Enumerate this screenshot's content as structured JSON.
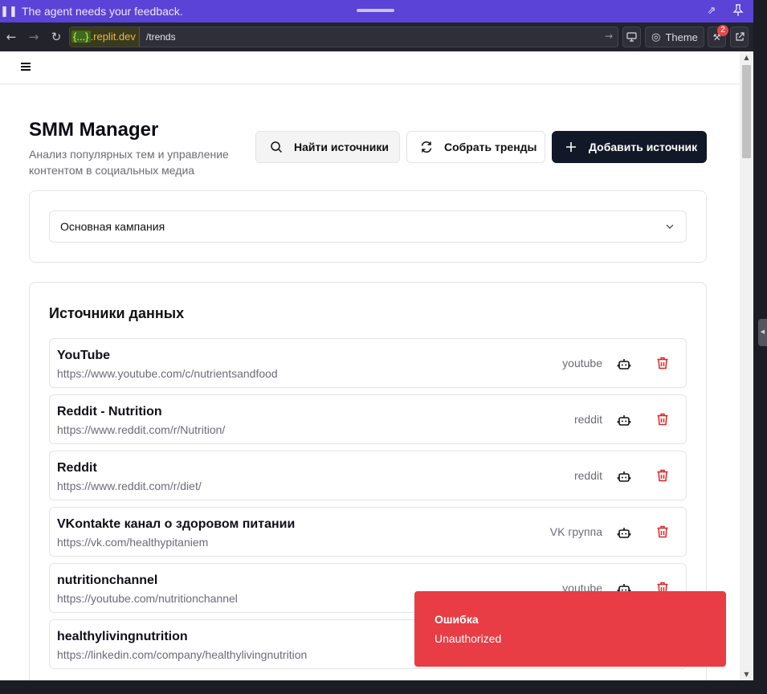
{
  "topbar": {
    "message": "The agent needs your feedback.",
    "pause_icon": "pause-icon",
    "expand_icon": "expand-icon",
    "pin_icon": "pin-icon"
  },
  "browser": {
    "host_prefix": "{...}",
    "host": ".replit.dev",
    "path": "/trends",
    "theme_label": "Theme",
    "devtools_badge": "2"
  },
  "app": {
    "title": "SMM Manager",
    "subtitle": "Анализ популярных тем и управление контентом в социальных медиа",
    "buttons": {
      "find": "Найти источники",
      "collect": "Собрать тренды",
      "add": "Добавить источник"
    },
    "campaign_select": "Основная кампания",
    "sources_title": "Источники данных",
    "sources": [
      {
        "name": "YouTube",
        "url": "https://www.youtube.com/c/nutrientsandfood",
        "type": "youtube"
      },
      {
        "name": "Reddit - Nutrition",
        "url": "https://www.reddit.com/r/Nutrition/",
        "type": "reddit"
      },
      {
        "name": "Reddit",
        "url": "https://www.reddit.com/r/diet/",
        "type": "reddit"
      },
      {
        "name": "VKontakte канал о здоровом питании",
        "url": "https://vk.com/healthypitaniem",
        "type": "VK группа"
      },
      {
        "name": "nutritionchannel",
        "url": "https://youtube.com/nutritionchannel",
        "type": "youtube"
      },
      {
        "name": "healthylivingnutrition",
        "url": "https://linkedin.com/company/healthylivingnutrition",
        "type": ""
      }
    ]
  },
  "toast": {
    "title": "Ошибка",
    "message": "Unauthorized"
  },
  "colors": {
    "topbar": "#5a43d6",
    "primary_button": "#111827",
    "toast": "#e83d44",
    "delete_icon": "#dc2626"
  }
}
